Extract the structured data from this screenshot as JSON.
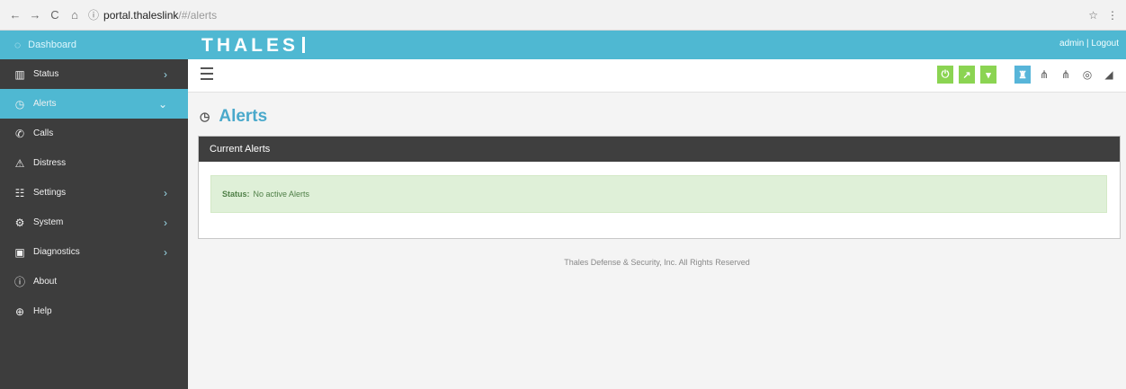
{
  "browser": {
    "url_host": "portal.thaleslink",
    "url_path": "/#/alerts"
  },
  "header": {
    "brand": "THALES",
    "user_links": "admin | Logout"
  },
  "sidebar": {
    "dashboard": "Dashboard",
    "items": [
      {
        "label": "Status",
        "icon": "bar-chart-icon",
        "has_chevron": true
      },
      {
        "label": "Alerts",
        "icon": "alert-icon",
        "has_chevron": true,
        "active": true
      },
      {
        "label": "Calls",
        "icon": "phone-icon",
        "has_chevron": false
      },
      {
        "label": "Distress",
        "icon": "warning-icon",
        "has_chevron": false
      },
      {
        "label": "Settings",
        "icon": "settings-icon",
        "has_chevron": true
      },
      {
        "label": "System",
        "icon": "gear-icon",
        "has_chevron": true
      },
      {
        "label": "Diagnostics",
        "icon": "briefcase-icon",
        "has_chevron": true
      },
      {
        "label": "About",
        "icon": "info-icon",
        "has_chevron": false
      },
      {
        "label": "Help",
        "icon": "help-icon",
        "has_chevron": false
      }
    ]
  },
  "page": {
    "title": "Alerts",
    "panel_title": "Current Alerts",
    "status_label": "Status:",
    "status_value": "No active Alerts"
  },
  "footer": {
    "text": "Thales Defense & Security, Inc. All Rights Reserved"
  },
  "colors": {
    "accent": "#4fb8d2",
    "sidebar": "#3d3d3d",
    "green": "#8bd452",
    "alert_bg": "#dff0d8"
  }
}
